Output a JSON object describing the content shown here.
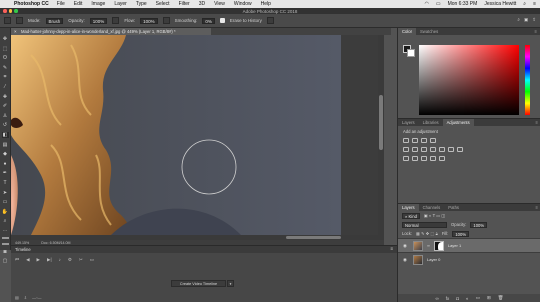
{
  "menubar": {
    "app_name": "Photoshop CC",
    "items": [
      "File",
      "Edit",
      "Image",
      "Layer",
      "Type",
      "Select",
      "Filter",
      "3D",
      "View",
      "Window",
      "Help"
    ],
    "clock": "Mon 6:33 PM",
    "user": "Jessica Hewitt"
  },
  "window": {
    "title": "Adobe Photoshop CC 2018"
  },
  "options": {
    "mode_label": "Mode:",
    "mode_value": "Brush",
    "opacity_label": "Opacity:",
    "opacity_value": "100%",
    "flow_label": "Flow:",
    "flow_value": "100%",
    "smoothing_label": "Smoothing:",
    "smoothing_value": "0%",
    "erase_history_label": "Erase to History"
  },
  "document": {
    "tab_title": "Mad-hatter-johnny-depp-in-alice-in-wonderland_xf.jpg @ 449% (Layer 1, RGB/8#) *",
    "zoom": "449.15%",
    "doc_size": "Doc: 6.50M/14.0M"
  },
  "timeline": {
    "title": "Timeline",
    "create_button": "Create Video Timeline"
  },
  "color_panel": {
    "tabs": [
      "Color",
      "Swatches"
    ],
    "accent_hue": "#ff0000"
  },
  "adjustments_panel": {
    "tabs": [
      "Layers",
      "Libraries",
      "Adjustments"
    ],
    "add_label": "Add an adjustment"
  },
  "layers_panel": {
    "tabs": [
      "Layers",
      "Channels",
      "Paths"
    ],
    "kind_filter": "Kind",
    "blend_mode": "Normal",
    "opacity_label": "Opacity:",
    "opacity_value": "100%",
    "lock_label": "Lock:",
    "fill_label": "Fill:",
    "fill_value": "100%",
    "layers": [
      {
        "name": "Layer 1",
        "selected": true
      },
      {
        "name": "Layer 0",
        "selected": false
      }
    ]
  }
}
